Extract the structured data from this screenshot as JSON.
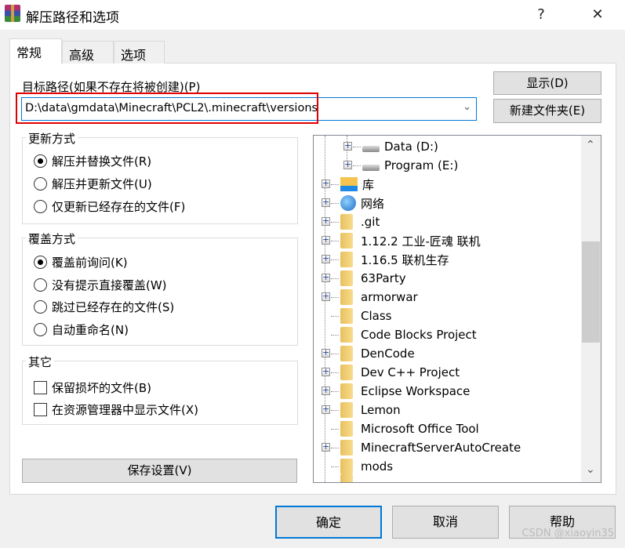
{
  "window": {
    "title": "解压路径和选项",
    "help": "?",
    "close": "✕"
  },
  "tabs": [
    {
      "label": "常规"
    },
    {
      "label": "高级"
    },
    {
      "label": "选项"
    }
  ],
  "destination": {
    "label": "目标路径(如果不存在将被创建)(P)",
    "value": "D:\\data\\gmdata\\Minecraft\\PCL2\\.minecraft\\versions"
  },
  "buttons": {
    "show": "显示(D)",
    "new_folder": "新建文件夹(E)",
    "save": "保存设置(V)",
    "ok": "确定",
    "cancel": "取消",
    "help": "帮助"
  },
  "update_mode": {
    "title": "更新方式",
    "options": [
      "解压并替换文件(R)",
      "解压并更新文件(U)",
      "仅更新已经存在的文件(F)"
    ],
    "selected": 0
  },
  "overwrite_mode": {
    "title": "覆盖方式",
    "options": [
      "覆盖前询问(K)",
      "没有提示直接覆盖(W)",
      "跳过已经存在的文件(S)",
      "自动重命名(N)"
    ],
    "selected": 0
  },
  "misc": {
    "title": "其它",
    "options": [
      "保留损坏的文件(B)",
      "在资源管理器中显示文件(X)"
    ]
  },
  "tree": [
    {
      "label": "Data (D:)",
      "icon": "drive",
      "level": 1,
      "expandable": true
    },
    {
      "label": "Program (E:)",
      "icon": "drive",
      "level": 1,
      "expandable": true
    },
    {
      "label": "库",
      "icon": "library",
      "level": 0,
      "expandable": true
    },
    {
      "label": "网络",
      "icon": "network",
      "level": 0,
      "expandable": true
    },
    {
      "label": ".git",
      "icon": "folder",
      "level": 0,
      "expandable": true
    },
    {
      "label": "1.12.2 工业-匠魂 联机",
      "icon": "folder",
      "level": 0,
      "expandable": true
    },
    {
      "label": "1.16.5 联机生存",
      "icon": "folder",
      "level": 0,
      "expandable": true
    },
    {
      "label": "63Party",
      "icon": "folder",
      "level": 0,
      "expandable": true
    },
    {
      "label": "armorwar",
      "icon": "folder",
      "level": 0,
      "expandable": true
    },
    {
      "label": "Class",
      "icon": "folder",
      "level": 0,
      "expandable": false
    },
    {
      "label": "Code Blocks Project",
      "icon": "folder",
      "level": 0,
      "expandable": false
    },
    {
      "label": "DenCode",
      "icon": "folder",
      "level": 0,
      "expandable": true
    },
    {
      "label": "Dev C++ Project",
      "icon": "folder",
      "level": 0,
      "expandable": true
    },
    {
      "label": "Eclipse Workspace",
      "icon": "folder",
      "level": 0,
      "expandable": true
    },
    {
      "label": "Lemon",
      "icon": "folder",
      "level": 0,
      "expandable": true
    },
    {
      "label": "Microsoft Office Tool",
      "icon": "folder",
      "level": 0,
      "expandable": false
    },
    {
      "label": "MinecraftServerAutoCreate",
      "icon": "folder",
      "level": 0,
      "expandable": true
    },
    {
      "label": "mods",
      "icon": "folder",
      "level": 0,
      "expandable": false
    }
  ],
  "watermark": "CSDN @xiaoyin35"
}
